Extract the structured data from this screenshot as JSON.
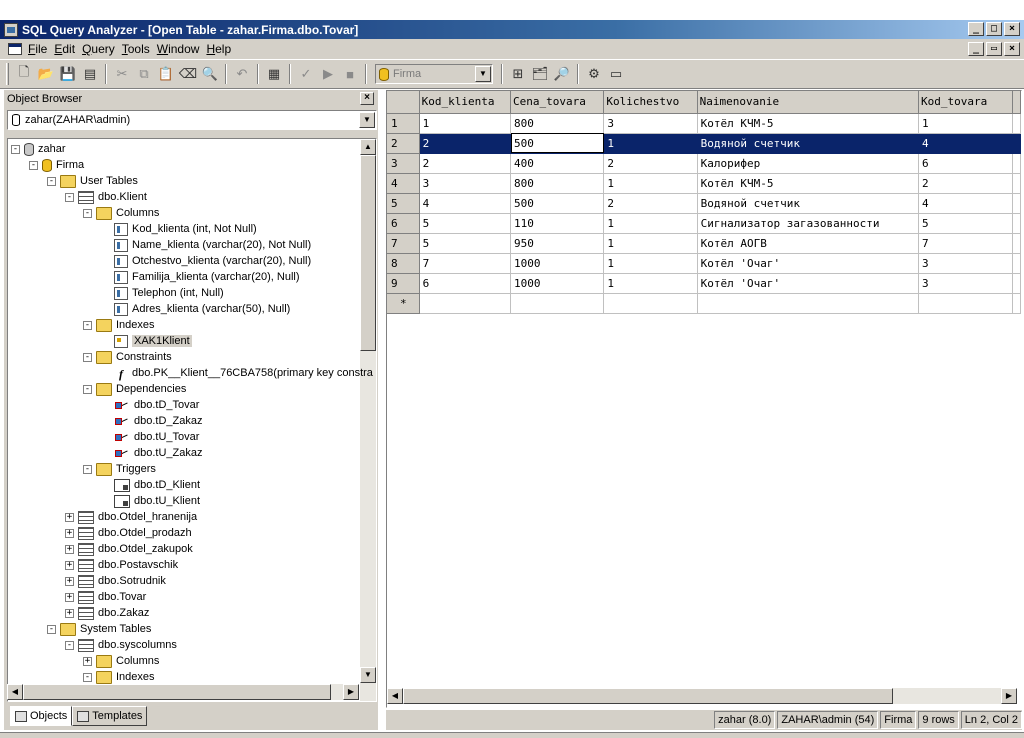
{
  "window": {
    "title": "SQL Query Analyzer - [Open Table - zahar.Firma.dbo.Tovar]",
    "btn_min": "_",
    "btn_max": "□",
    "btn_close": "×",
    "mdi_restore": "▭"
  },
  "menu": [
    "File",
    "Edit",
    "Query",
    "Tools",
    "Window",
    "Help"
  ],
  "toolbar": {
    "db_value": "Firma"
  },
  "object_browser": {
    "title": "Object Browser",
    "server": "zahar(ZAHAR\\admin)",
    "tree": [
      {
        "label": "zahar",
        "icon": "server-icon"
      },
      {
        "label": "Firma",
        "icon": "database-icon"
      },
      {
        "label": "User Tables",
        "icon": "folder-icon"
      },
      {
        "label": "dbo.Klient",
        "icon": "table-icon"
      },
      {
        "label": "Columns",
        "icon": "folder-icon"
      },
      {
        "label": "Kod_klienta (int, Not Null)",
        "icon": "column-icon"
      },
      {
        "label": "Name_klienta (varchar(20), Not Null)",
        "icon": "column-icon"
      },
      {
        "label": "Otchestvo_klienta (varchar(20), Null)",
        "icon": "column-icon"
      },
      {
        "label": "Familija_klienta (varchar(20), Null)",
        "icon": "column-icon"
      },
      {
        "label": "Telephon (int, Null)",
        "icon": "column-icon"
      },
      {
        "label": "Adres_klienta (varchar(50), Null)",
        "icon": "column-icon"
      },
      {
        "label": "Indexes",
        "icon": "folder-icon"
      },
      {
        "label": "XAK1Klient",
        "icon": "index-icon"
      },
      {
        "label": "Constraints",
        "icon": "folder-icon"
      },
      {
        "label": "dbo.PK__Klient__76CBA758(primary key constra",
        "icon": "function-icon"
      },
      {
        "label": "Dependencies",
        "icon": "folder-icon"
      },
      {
        "label": "dbo.tD_Tovar",
        "icon": "dependency-icon"
      },
      {
        "label": "dbo.tD_Zakaz",
        "icon": "dependency-icon"
      },
      {
        "label": "dbo.tU_Tovar",
        "icon": "dependency-icon"
      },
      {
        "label": "dbo.tU_Zakaz",
        "icon": "dependency-icon"
      },
      {
        "label": "Triggers",
        "icon": "folder-icon"
      },
      {
        "label": "dbo.tD_Klient",
        "icon": "trigger-icon"
      },
      {
        "label": "dbo.tU_Klient",
        "icon": "trigger-icon"
      },
      {
        "label": "dbo.Otdel_hranenija",
        "icon": "table-icon"
      },
      {
        "label": "dbo.Otdel_prodazh",
        "icon": "table-icon"
      },
      {
        "label": "dbo.Otdel_zakupok",
        "icon": "table-icon"
      },
      {
        "label": "dbo.Postavschik",
        "icon": "table-icon"
      },
      {
        "label": "dbo.Sotrudnik",
        "icon": "table-icon"
      },
      {
        "label": "dbo.Tovar",
        "icon": "table-icon"
      },
      {
        "label": "dbo.Zakaz",
        "icon": "table-icon"
      },
      {
        "label": "System Tables",
        "icon": "folder-icon"
      },
      {
        "label": "dbo.syscolumns",
        "icon": "table-icon"
      },
      {
        "label": "Columns",
        "icon": "folder-icon"
      },
      {
        "label": "Indexes",
        "icon": "folder-icon"
      }
    ],
    "tabs": [
      "Objects",
      "Templates"
    ]
  },
  "grid": {
    "columns": [
      "Kod_klienta",
      "Cena_tovara",
      "Kolichestvo",
      "Naimenovanie",
      "Kod_tovara"
    ],
    "rows": [
      {
        "n": "1",
        "cells": [
          "1",
          "800",
          "3",
          "Котёл КЧМ-5",
          "1"
        ]
      },
      {
        "n": "2",
        "cells": [
          "2",
          "500",
          "1",
          "Водяной счетчик",
          "4"
        ]
      },
      {
        "n": "3",
        "cells": [
          "2",
          "400",
          "2",
          "Калорифер",
          "6"
        ]
      },
      {
        "n": "4",
        "cells": [
          "3",
          "800",
          "1",
          "Котёл КЧМ-5",
          "2"
        ]
      },
      {
        "n": "5",
        "cells": [
          "4",
          "500",
          "2",
          "Водяной счетчик",
          "4"
        ]
      },
      {
        "n": "6",
        "cells": [
          "5",
          "110",
          "1",
          "Сигнализатор загазованности",
          "5"
        ]
      },
      {
        "n": "7",
        "cells": [
          "5",
          "950",
          "1",
          "Котёл АОГВ",
          "7"
        ]
      },
      {
        "n": "8",
        "cells": [
          "7",
          "1000",
          "1",
          "Котёл 'Очаг'",
          "3"
        ]
      },
      {
        "n": "9",
        "cells": [
          "6",
          "1000",
          "1",
          "Котёл 'Очаг'",
          "3"
        ]
      }
    ],
    "new_row_marker": "*"
  },
  "status": {
    "server": "zahar (8.0)",
    "user": "ZAHAR\\admin (54)",
    "db": "Firma",
    "rows": "9 rows",
    "position": "Ln 2, Col 2"
  }
}
